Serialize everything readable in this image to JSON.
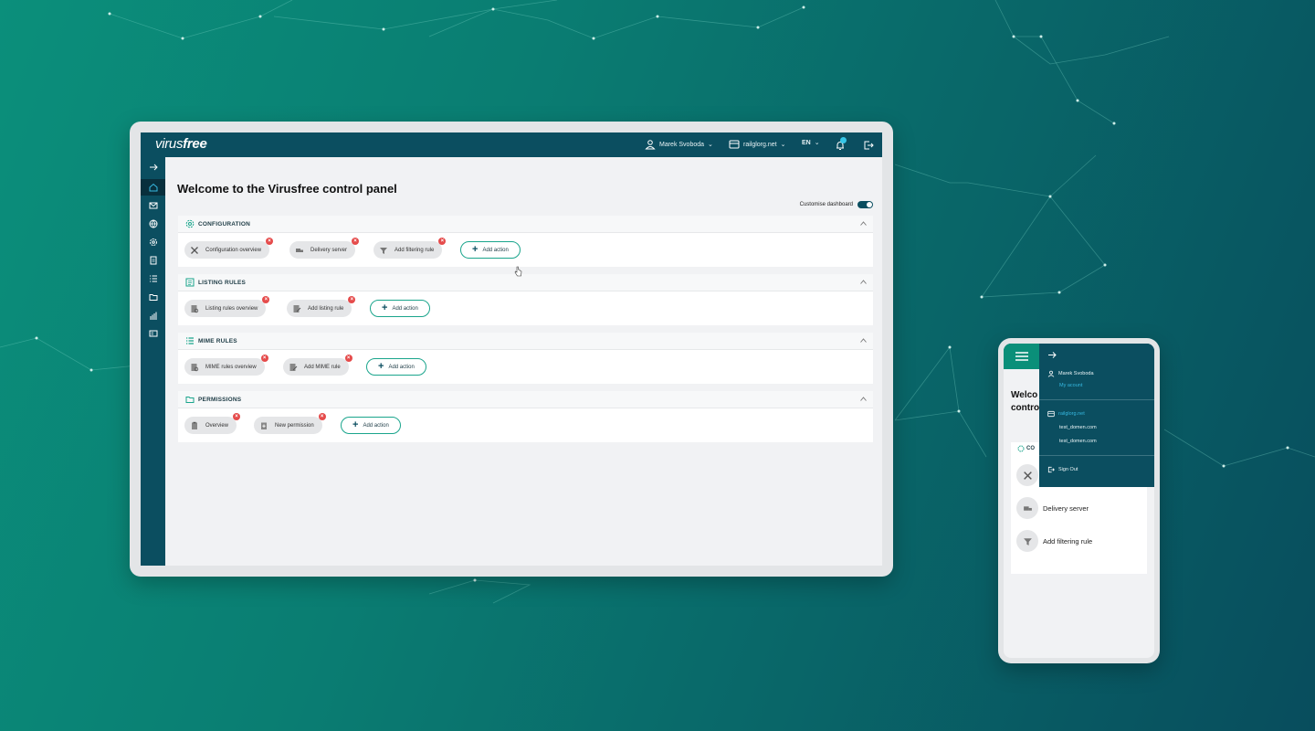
{
  "brand": {
    "logo_prefix": "virus",
    "logo_suffix": "free"
  },
  "topbar": {
    "user_name": "Marek Svoboda",
    "domain": "railglorg.net",
    "language": "EN",
    "icons": [
      "user-icon",
      "domain-icon",
      "bell-icon",
      "logout-icon"
    ]
  },
  "sidebar": {
    "items": [
      "expand-arrow-icon",
      "home-icon",
      "mail-icon",
      "globe-icon",
      "settings-icon",
      "document-icon",
      "list-icon",
      "folder-icon",
      "stats-icon",
      "id-card-icon"
    ],
    "active_index": 1
  },
  "main": {
    "title": "Welcome to the Virusfree control panel",
    "customise_label": "Customise dashboard",
    "customise_enabled": true,
    "add_action_label": "Add action",
    "panels": [
      {
        "title": "CONFIGURATION",
        "icon": "gear-icon",
        "chips": [
          "Configuration overview",
          "Delivery server",
          "Add filtering rule"
        ]
      },
      {
        "title": "LISTING RULES",
        "icon": "listing-icon",
        "chips": [
          "Listing rules overview",
          "Add listing rule"
        ]
      },
      {
        "title": "MIME RULES",
        "icon": "list-icon",
        "chips": [
          "MIME rules overview",
          "Add MIME rule"
        ]
      },
      {
        "title": "PERMISSIONS",
        "icon": "folder-icon",
        "chips": [
          "Overview",
          "New permission"
        ]
      }
    ]
  },
  "phone": {
    "welcome_line1": "Welco",
    "welcome_line2": "contro",
    "card_header_fragment": "CO",
    "card_items": [
      "Delivery server",
      "Add filtering rule"
    ],
    "menu": {
      "user_name": "Marek Svoboda",
      "my_account": "My acount",
      "domains": [
        "railglorg.net",
        "test_domen.com",
        "test_domen.com"
      ],
      "sign_out": "Sign Out"
    }
  },
  "colors": {
    "accent": "#1aa58c",
    "navy": "#0b4e60",
    "badge_red": "#e54b4b",
    "notification": "#35c6e8"
  }
}
